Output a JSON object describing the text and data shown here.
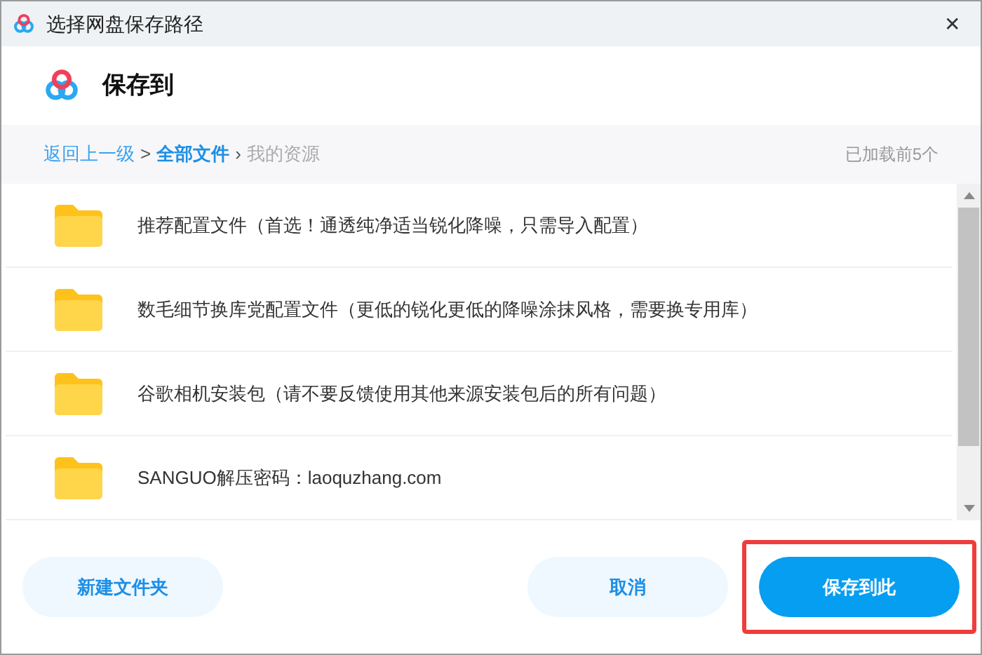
{
  "window": {
    "title": "选择网盘保存路径",
    "close": "✕"
  },
  "header": {
    "title": "保存到"
  },
  "breadcrumb": {
    "items": [
      {
        "kind": "link",
        "text": "返回上一级"
      },
      {
        "kind": "separator",
        "text": ">"
      },
      {
        "kind": "current",
        "text": "全部文件"
      },
      {
        "kind": "separator",
        "text": "›"
      },
      {
        "kind": "muted",
        "text": "我的资源"
      }
    ],
    "count": "已加载前5个"
  },
  "folders": [
    {
      "name": "推荐配置文件（首选！通透纯净适当锐化降噪，只需导入配置）"
    },
    {
      "name": "数毛细节换库党配置文件（更低的锐化更低的降噪涂抹风格，需要换专用库）"
    },
    {
      "name": "谷歌相机安装包（请不要反馈使用其他来源安装包后的所有问题）"
    },
    {
      "name": "SANGUO解压密码：laoquzhang.com"
    }
  ],
  "buttons": [
    {
      "kind": "secondary",
      "label": "新建文件夹",
      "highlighted": false
    },
    {
      "kind": "spacer"
    },
    {
      "kind": "secondary",
      "label": "取消",
      "highlighted": false
    },
    {
      "kind": "primary",
      "label": "保存到此",
      "highlighted": true
    }
  ]
}
